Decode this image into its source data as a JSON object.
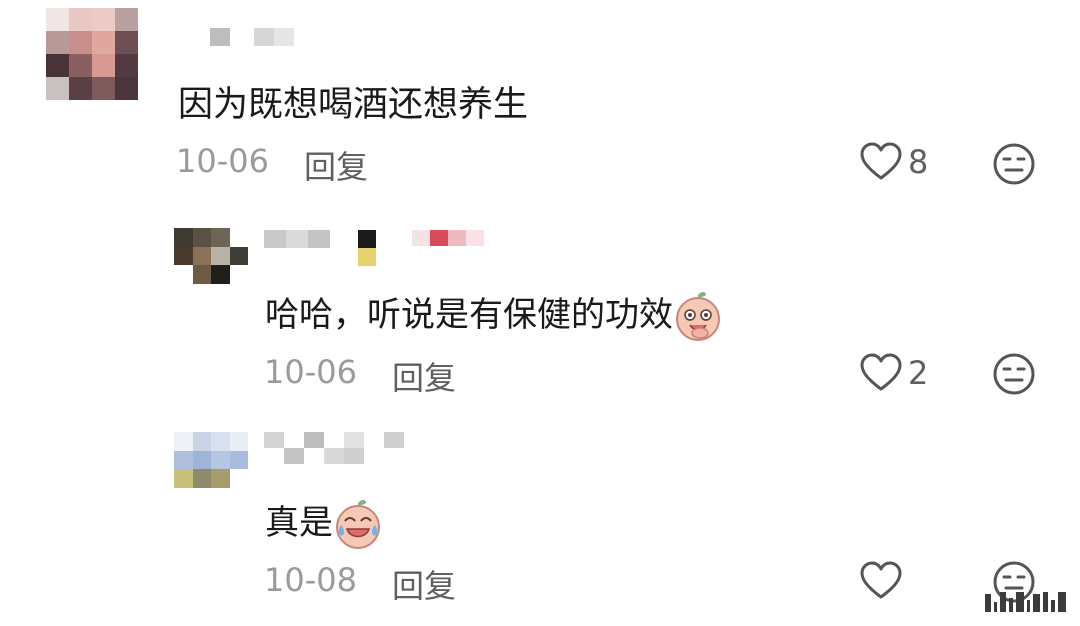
{
  "comments": [
    {
      "text": "因为既想喝酒还想养生",
      "date": "10-06",
      "reply_label": "回复",
      "like_count": "8"
    },
    {
      "text": "哈哈，听说是有保健的功效",
      "emoji": "laughing-emoji",
      "date": "10-06",
      "reply_label": "回复",
      "like_count": "2"
    },
    {
      "text": "真是",
      "emoji": "crying-laughing-emoji",
      "date": "10-08",
      "reply_label": "回复"
    }
  ],
  "icons": {
    "like": "heart-outline-icon",
    "dislike": "neutral-face-icon"
  },
  "colors": {
    "text": "#1a1a1a",
    "meta": "#9a9a9a",
    "reply": "#606060",
    "icon": "#555555",
    "background": "#ffffff"
  }
}
